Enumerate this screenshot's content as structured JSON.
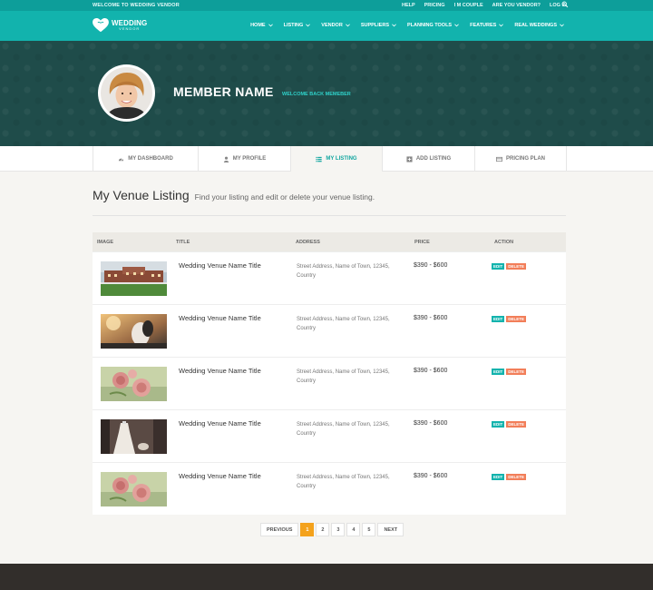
{
  "topbar": {
    "welcome": "WELCOME TO WEDDING VENDOR",
    "links": [
      "HELP",
      "PRICING",
      "I M COUPLE",
      "ARE YOU VENDOR?",
      "LOG IN"
    ]
  },
  "brand": {
    "line1": "WEDDING",
    "line2": "VENDOR"
  },
  "nav": [
    "HOME",
    "LISTING",
    "VENDOR",
    "SUPPLIERS",
    "PLANNING TOOLS",
    "FEATURES",
    "REAL WEDDINGS"
  ],
  "profile": {
    "name": "MEMBER NAME",
    "welcome": "WELCOME BACK MEMEBER"
  },
  "tabs": [
    {
      "label": "MY DASHBOARD",
      "icon": "dashboard-icon"
    },
    {
      "label": "MY PROFILE",
      "icon": "user-icon"
    },
    {
      "label": "MY LISTING",
      "icon": "list-icon",
      "active": true
    },
    {
      "label": "ADD LISTING",
      "icon": "plus-square-icon"
    },
    {
      "label": "PRICING PLAN",
      "icon": "card-icon"
    }
  ],
  "page": {
    "title": "My Venue Listing",
    "subtitle": "Find your listing and edit or delete your venue listing."
  },
  "table": {
    "headers": [
      "IMAGE",
      "TITLE",
      "ADDRESS",
      "PRICE",
      "ACTION"
    ],
    "rows": [
      {
        "title": "Wedding Venue Name Title",
        "address": "Street Address, Name of Town, 12345, Country",
        "price": "$390 - $600",
        "image": "venue-building-photo"
      },
      {
        "title": "Wedding Venue Name Title",
        "address": "Street Address, Name of Town, 12345, Country",
        "price": "$390 - $600",
        "image": "couple-sunset-photo"
      },
      {
        "title": "Wedding Venue Name Title",
        "address": "Street Address, Name of Town, 12345, Country",
        "price": "$390 - $600",
        "image": "pink-roses-photo"
      },
      {
        "title": "Wedding Venue Name Title",
        "address": "Street Address, Name of Town, 12345, Country",
        "price": "$390 - $600",
        "image": "wedding-dress-photo"
      },
      {
        "title": "Wedding Venue Name Title",
        "address": "Street Address, Name of Town, 12345, Country",
        "price": "$390 - $600",
        "image": "pink-roses-photo"
      }
    ],
    "edit_label": "EDIT",
    "delete_label": "DELETE"
  },
  "pagination": {
    "prev": "PREVIOUS",
    "pages": [
      "1",
      "2",
      "3",
      "4",
      "5"
    ],
    "next": "NEXT",
    "current": "1"
  },
  "colors": {
    "teal": "#12b3ad",
    "dark_teal": "#1f4c4a",
    "orange": "#f4a21c",
    "delete": "#f27e59"
  }
}
